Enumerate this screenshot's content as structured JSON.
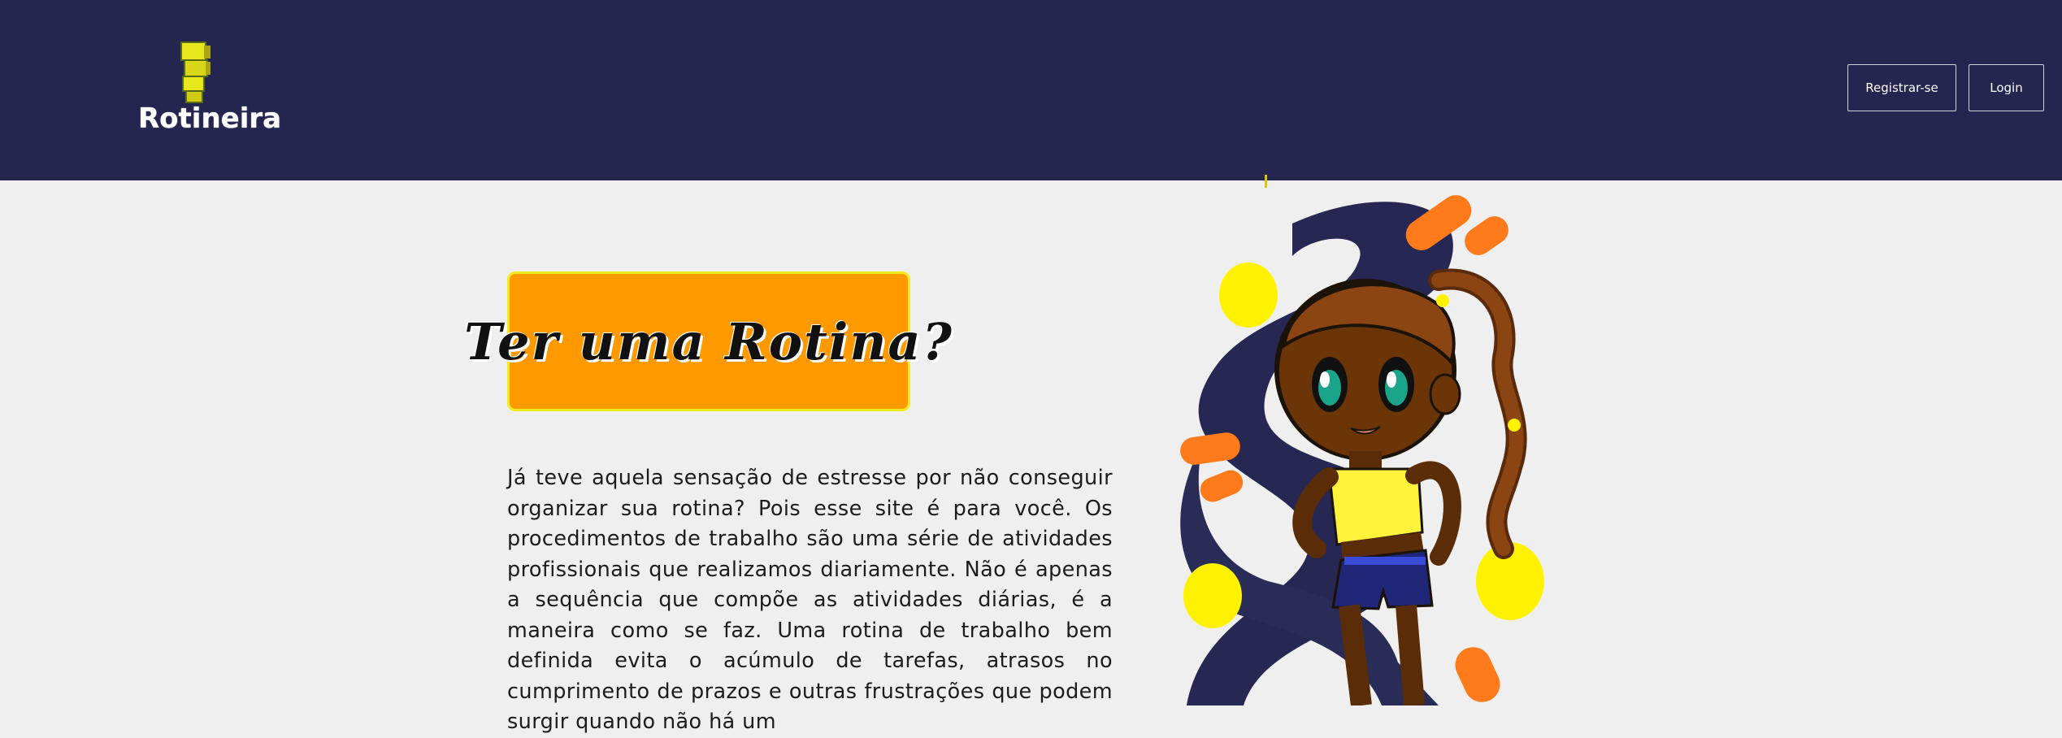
{
  "header": {
    "brand": "Rotineira",
    "register_label": "Registrar-se",
    "login_label": "Login"
  },
  "hero": {
    "title": "Ter uma Rotina?",
    "paragraph": "Já teve aquela sensação de estresse por não conseguir organizar sua rotina? Pois esse site é para você. Os procedimentos de trabalho são uma série de atividades profissionais que realizamos diariamente. Não é apenas a sequência que compõe as atividades diárias, é a maneira como se faz. Uma rotina de trabalho bem definida evita o acúmulo de tarefas, atrasos no cumprimento de prazos e outras frustrações que podem surgir quando não há um"
  },
  "colors": {
    "header_bg": "#24264f",
    "page_bg": "#efefef",
    "accent_orange": "#ff9900",
    "accent_yellow": "#f2ec1e"
  }
}
